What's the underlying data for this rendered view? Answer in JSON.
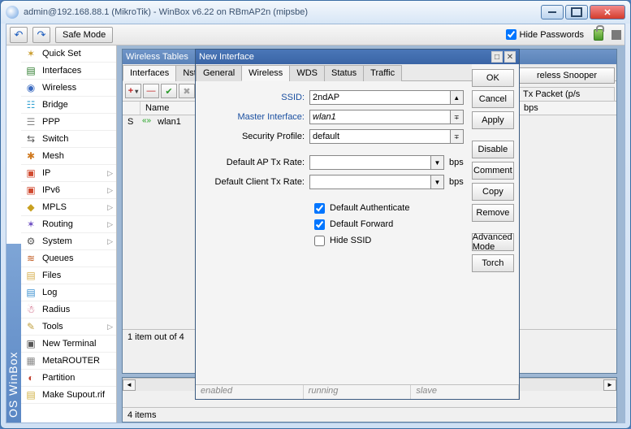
{
  "window": {
    "title": "admin@192.168.88.1 (MikroTik) - WinBox v6.22 on RBmAP2n (mipsbe)"
  },
  "toolbar": {
    "safe_mode": "Safe Mode",
    "hide_passwords": "Hide Passwords"
  },
  "sidebar": {
    "tag": "OS WinBox",
    "items": [
      {
        "label": "Quick Set",
        "icon": "ic-quick",
        "glyph": "✶",
        "expand": false
      },
      {
        "label": "Interfaces",
        "icon": "ic-iface",
        "glyph": "▤",
        "expand": false
      },
      {
        "label": "Wireless",
        "icon": "ic-wl",
        "glyph": "◉",
        "expand": false
      },
      {
        "label": "Bridge",
        "icon": "ic-br",
        "glyph": "☷",
        "expand": false
      },
      {
        "label": "PPP",
        "icon": "ic-ppp",
        "glyph": "☰",
        "expand": false
      },
      {
        "label": "Switch",
        "icon": "ic-sw",
        "glyph": "⇆",
        "expand": false
      },
      {
        "label": "Mesh",
        "icon": "ic-mesh",
        "glyph": "✱",
        "expand": false
      },
      {
        "label": "IP",
        "icon": "ic-ip",
        "glyph": "▣",
        "expand": true
      },
      {
        "label": "IPv6",
        "icon": "ic-ip6",
        "glyph": "▣",
        "expand": true
      },
      {
        "label": "MPLS",
        "icon": "ic-mpls",
        "glyph": "◆",
        "expand": true
      },
      {
        "label": "Routing",
        "icon": "ic-rt",
        "glyph": "✶",
        "expand": true
      },
      {
        "label": "System",
        "icon": "ic-sys",
        "glyph": "⚙",
        "expand": true
      },
      {
        "label": "Queues",
        "icon": "ic-q",
        "glyph": "≋",
        "expand": false
      },
      {
        "label": "Files",
        "icon": "ic-fl",
        "glyph": "▤",
        "expand": false
      },
      {
        "label": "Log",
        "icon": "ic-log",
        "glyph": "▤",
        "expand": false
      },
      {
        "label": "Radius",
        "icon": "ic-rad",
        "glyph": "☃",
        "expand": false
      },
      {
        "label": "Tools",
        "icon": "ic-tl",
        "glyph": "✎",
        "expand": true
      },
      {
        "label": "New Terminal",
        "icon": "ic-nt",
        "glyph": "▣",
        "expand": false
      },
      {
        "label": "MetaROUTER",
        "icon": "ic-mr",
        "glyph": "▦",
        "expand": false
      },
      {
        "label": "Partition",
        "icon": "ic-pt",
        "glyph": "◐",
        "expand": false
      },
      {
        "label": "Make Supout.rif",
        "icon": "ic-su",
        "glyph": "▤",
        "expand": false
      }
    ]
  },
  "wireless_tables": {
    "title": "Wireless Tables",
    "tabs": [
      "Interfaces",
      "Nstr"
    ],
    "active_tab": 0,
    "columns": {
      "flag": "",
      "name": "Name"
    },
    "rows": [
      {
        "flag": "S",
        "icon": "«»",
        "name": "wlan1"
      }
    ],
    "footer": "1 item out of 4",
    "lower_footer": "4 items"
  },
  "right_panel": {
    "snooper_btn": "reless Snooper",
    "col_header": "Tx Packet (p/s",
    "unit": "bps"
  },
  "dialog": {
    "title": "New Interface",
    "tabs": [
      "General",
      "Wireless",
      "WDS",
      "Status",
      "Traffic"
    ],
    "active_tab": 1,
    "fields": {
      "ssid_label": "SSID:",
      "ssid_value": "2ndAP",
      "master_label": "Master Interface:",
      "master_value": "wlan1",
      "sec_label": "Security Profile:",
      "sec_value": "default",
      "ap_tx_label": "Default AP Tx Rate:",
      "ap_tx_value": "",
      "cl_tx_label": "Default Client Tx Rate:",
      "cl_tx_value": "",
      "unit": "bps",
      "cb_auth": "Default Authenticate",
      "cb_fwd": "Default Forward",
      "cb_hide": "Hide SSID"
    },
    "buttons": {
      "ok": "OK",
      "cancel": "Cancel",
      "apply": "Apply",
      "disable": "Disable",
      "comment": "Comment",
      "copy": "Copy",
      "remove": "Remove",
      "advanced": "Advanced Mode",
      "torch": "Torch"
    },
    "status": {
      "enabled": "enabled",
      "running": "running",
      "slave": "slave"
    }
  }
}
